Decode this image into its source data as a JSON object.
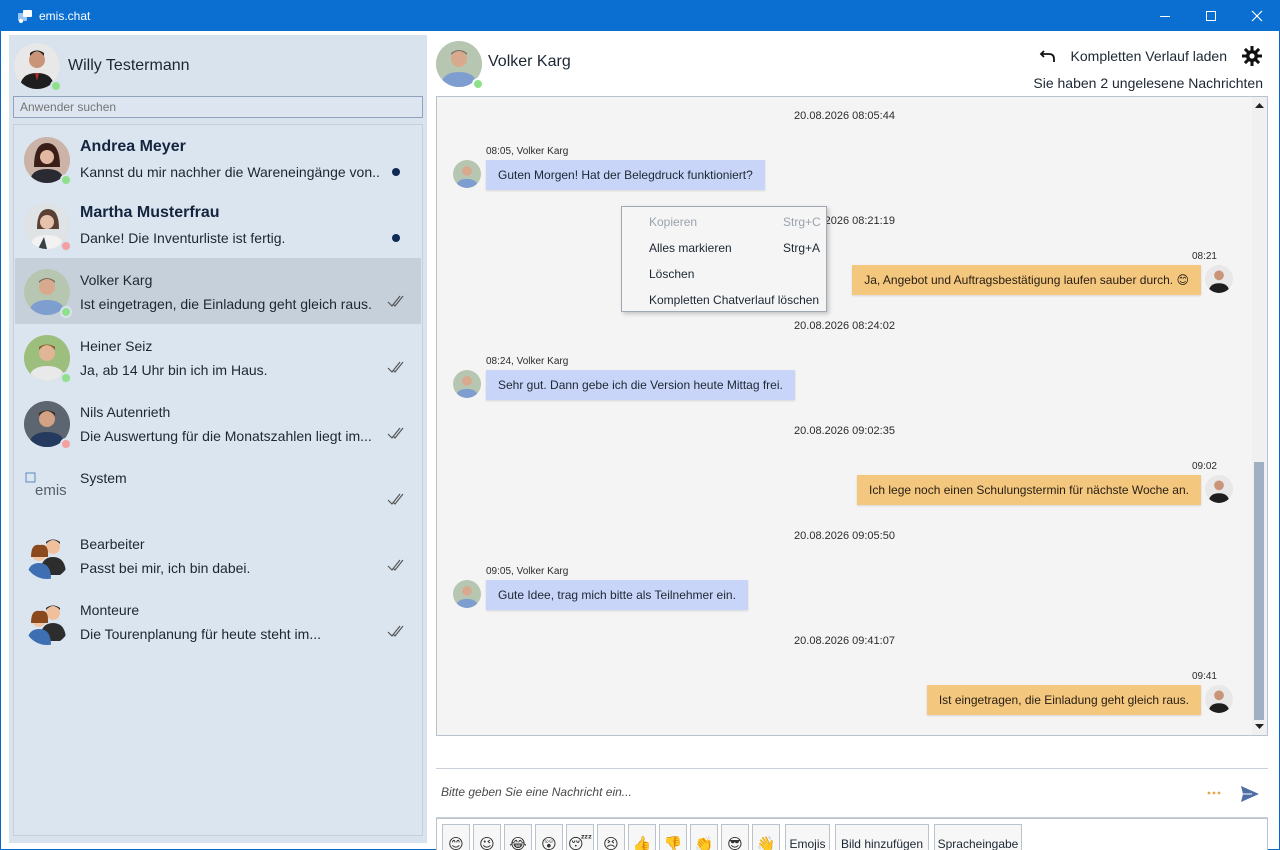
{
  "window": {
    "title": "emis.chat",
    "controls": [
      "minimize-icon",
      "maximize-icon",
      "close-icon"
    ]
  },
  "current_user": {
    "name": "Willy Testermann",
    "status_color": "#8fe08a"
  },
  "search": {
    "placeholder": "Anwender suchen"
  },
  "contacts": [
    {
      "name": "Andrea Meyer",
      "message": "Kannst du mir nachher die Wareneingänge von...",
      "bold": true,
      "status_color": "#8fe08a",
      "indicator": "unread"
    },
    {
      "name": "Martha Musterfrau",
      "message": "Danke! Die Inventurliste ist fertig.",
      "bold": true,
      "status_color": "#f3a0a0",
      "indicator": "unread"
    },
    {
      "name": "Volker Karg",
      "message": "Ist eingetragen, die Einladung geht gleich raus.",
      "bold": false,
      "status_color": "#8fe08a",
      "indicator": "read",
      "selected": true
    },
    {
      "name": "Heiner Seiz",
      "message": "Ja, ab 14 Uhr bin ich im Haus.",
      "bold": false,
      "status_color": "#8fe08a",
      "indicator": "read"
    },
    {
      "name": "Nils Autenrieth",
      "message": "Die Auswertung für die Monatszahlen liegt im...",
      "bold": false,
      "status_color": "#f3a0a0",
      "indicator": "read"
    },
    {
      "name": "System",
      "message": "",
      "bold": false,
      "indicator": "read",
      "logo_text": "emis"
    },
    {
      "name": "Bearbeiter",
      "message": "Passt bei mir, ich bin dabei.",
      "bold": false,
      "indicator": "read"
    },
    {
      "name": "Monteure",
      "message": "Die Tourenplanung für heute steht im...",
      "bold": false,
      "indicator": "read"
    }
  ],
  "chat": {
    "partner": "Volker Karg",
    "partner_status_color": "#8fe08a",
    "load_history_label": "Kompletten Verlauf laden",
    "unread_info": "Sie haben 2 ungelesene Nachrichten",
    "messages": [
      {
        "timestamp": "20.08.2026 08:05:44",
        "meta": "08:05, Volker Karg",
        "text": "Guten Morgen! Hat der Belegdruck funktioniert?",
        "direction": "in"
      },
      {
        "timestamp": "20.08.2026 08:21:19",
        "meta": "08:21",
        "text": "Ja, Angebot und Auftragsbestätigung laufen sauber durch. 😊",
        "direction": "out"
      },
      {
        "timestamp": "20.08.2026 08:24:02",
        "meta": "08:24, Volker Karg",
        "text": "Sehr gut. Dann gebe ich die Version heute Mittag frei.",
        "direction": "in"
      },
      {
        "timestamp": "20.08.2026 09:02:35",
        "meta": "09:02",
        "text": "Ich lege noch einen Schulungstermin für nächste Woche an.",
        "direction": "out"
      },
      {
        "timestamp": "20.08.2026 09:05:50",
        "meta": "09:05, Volker Karg",
        "text": "Gute Idee, trag mich bitte als Teilnehmer ein.",
        "direction": "in"
      },
      {
        "timestamp": "20.08.2026 09:41:07",
        "meta": "09:41",
        "text": "Ist eingetragen, die Einladung geht gleich raus.",
        "direction": "out"
      }
    ]
  },
  "context_menu": {
    "items": [
      {
        "label": "Kopieren",
        "shortcut": "Strg+C",
        "disabled": true
      },
      {
        "label": "Alles markieren",
        "shortcut": "Strg+A",
        "disabled": false
      },
      {
        "label": "Löschen",
        "shortcut": "",
        "disabled": false
      },
      {
        "label": "Kompletten Chatverlauf löschen",
        "shortcut": "",
        "disabled": false
      }
    ]
  },
  "composer": {
    "placeholder": "Bitte geben Sie eine Nachricht ein..."
  },
  "toolbar": {
    "emoji_buttons": [
      "😊",
      "😉",
      "😂",
      "😲",
      "😴",
      "😣",
      "👍",
      "👎",
      "👏",
      "😎",
      "👋"
    ],
    "emojis_label": "Emojis",
    "add_image_label": "Bild hinzufügen",
    "voice_label": "Spracheingabe"
  },
  "colors": {
    "titlebar": "#0a6fd1",
    "sidebar_bg": "#d9e3ee",
    "incoming_bubble": "#c9d5f8",
    "outgoing_bubble": "#f4c77f",
    "online": "#8fe08a",
    "busy": "#f3a0a0"
  }
}
